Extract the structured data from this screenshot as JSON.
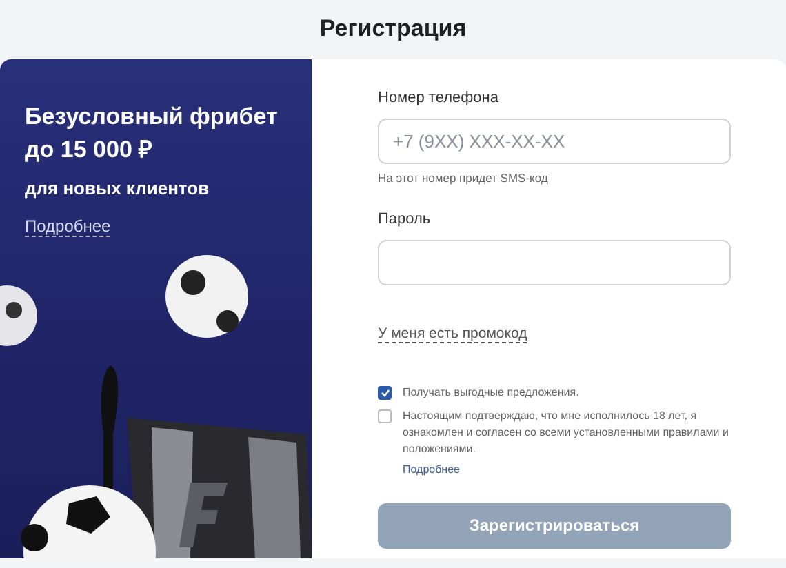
{
  "header": {
    "title": "Регистрация"
  },
  "promo": {
    "headline": "Безусловный фрибет до 15 000 ₽",
    "subtitle": "для новых клиентов",
    "link": "Подробнее"
  },
  "form": {
    "phone": {
      "label": "Номер телефона",
      "placeholder": "+7 (9XX) XXX-XX-XX",
      "hint": "На этот номер придет SMS-код"
    },
    "password": {
      "label": "Пароль"
    },
    "promo_link": "У меня есть промокод",
    "checkboxes": [
      {
        "label": "Получать выгодные предложения.",
        "checked": true
      },
      {
        "label": "Настоящим подтверждаю, что мне исполнилось 18 лет, я ознакомлен и согласен со всеми установленными правилами и положениями.",
        "checked": false,
        "link": "Подробнее"
      }
    ],
    "submit": {
      "label": "Зарегистрироваться",
      "disabled": true
    }
  }
}
